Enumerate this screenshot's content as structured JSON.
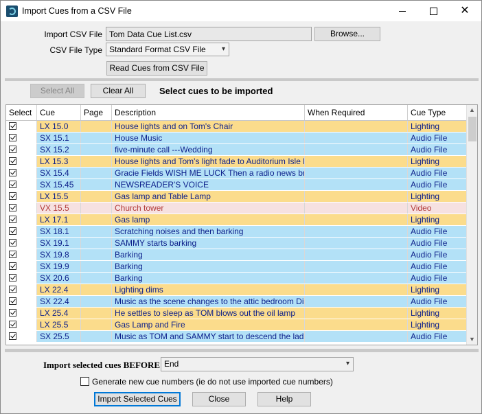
{
  "window": {
    "title": "Import Cues from a CSV File"
  },
  "form": {
    "import_file_label": "Import CSV File",
    "import_file_value": "Tom Data Cue List.csv",
    "browse_label": "Browse...",
    "file_type_label": "CSV File Type",
    "file_type_value": "Standard Format CSV File",
    "read_label": "Read Cues from CSV File"
  },
  "toolbar": {
    "select_all_label": "Select All",
    "clear_all_label": "Clear All",
    "heading": "Select cues to be imported"
  },
  "table": {
    "columns": [
      "Select",
      "Cue",
      "Page",
      "Description",
      "When Required",
      "Cue Type"
    ],
    "rows": [
      {
        "cue": "LX 15.0",
        "page": "",
        "desc": "House lights and on Tom's Chair",
        "when": "",
        "type": "Lighting"
      },
      {
        "cue": "SX 15.1",
        "page": "",
        "desc": "House Music",
        "when": "",
        "type": "Audio File"
      },
      {
        "cue": "SX 15.2",
        "page": "",
        "desc": "five-minute call ---Wedding",
        "when": "",
        "type": "Audio File"
      },
      {
        "cue": "LX 15.3",
        "page": "",
        "desc": "House lights and Tom's light fade to Auditorium Isle lig...",
        "when": "",
        "type": "Lighting"
      },
      {
        "cue": "SX 15.4",
        "page": "",
        "desc": "Gracie Fields WISH ME LUCK  Then a radio news broa...",
        "when": "",
        "type": "Audio File"
      },
      {
        "cue": "SX 15.45",
        "page": "",
        "desc": "NEWSREADER'S VOICE",
        "when": "",
        "type": "Audio File"
      },
      {
        "cue": "LX 15.5",
        "page": "",
        "desc": "Gas lamp and Table Lamp",
        "when": "",
        "type": "Lighting"
      },
      {
        "cue": "VX 15.5",
        "page": "",
        "desc": "Church tower",
        "when": "",
        "type": "Video"
      },
      {
        "cue": "LX 17.1",
        "page": "",
        "desc": "Gas lamp",
        "when": "",
        "type": "Lighting"
      },
      {
        "cue": "SX 18.1",
        "page": "",
        "desc": "Scratching noises and then barking",
        "when": "",
        "type": "Audio File"
      },
      {
        "cue": "SX 19.1",
        "page": "",
        "desc": "SAMMY starts barking",
        "when": "",
        "type": "Audio File"
      },
      {
        "cue": "SX 19.8",
        "page": "",
        "desc": "Barking",
        "when": "",
        "type": "Audio File"
      },
      {
        "cue": "SX 19.9",
        "page": "",
        "desc": "Barking",
        "when": "",
        "type": "Audio File"
      },
      {
        "cue": "SX 20.6",
        "page": "",
        "desc": "Barking",
        "when": "",
        "type": "Audio File"
      },
      {
        "cue": "LX 22.4",
        "page": "",
        "desc": "Lighting dims",
        "when": "",
        "type": "Lighting"
      },
      {
        "cue": "SX 22.4",
        "page": "",
        "desc": "Music as the scene changes to the attic bedroom  Dim...",
        "when": "",
        "type": "Audio File"
      },
      {
        "cue": "LX 25.4",
        "page": "",
        "desc": "He settles to sleep as TOM blows out the oil lamp",
        "when": "",
        "type": "Lighting"
      },
      {
        "cue": "LX 25.5",
        "page": "",
        "desc": "Gas Lamp and Fire",
        "when": "",
        "type": "Lighting"
      },
      {
        "cue": "SX 25.5",
        "page": "",
        "desc": "Music as TOM and SAMMY start to descend the ladder",
        "when": "",
        "type": "Audio File"
      }
    ]
  },
  "footer": {
    "before_label": "Import selected cues BEFORE",
    "before_value": "End",
    "generate_label": "Generate new cue numbers (ie do not use imported cue numbers)",
    "import_label": "Import Selected Cues",
    "close_label": "Close",
    "help_label": "Help"
  }
}
